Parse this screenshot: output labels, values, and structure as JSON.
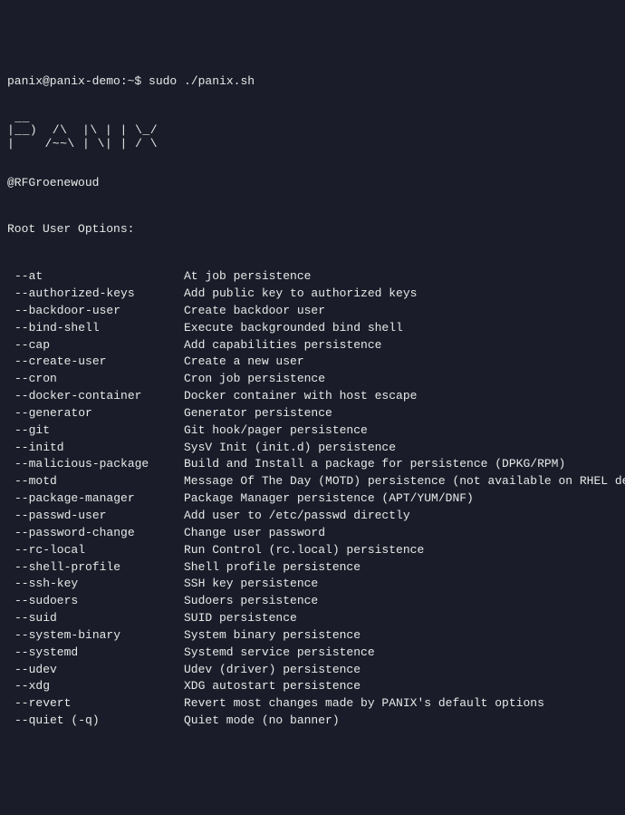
{
  "prompt": "panix@panix-demo:~$ sudo ./panix.sh",
  "ascii_art": " __\n|__)  /\\  |\\ | | \\_/\n|    /~~\\ | \\| | / \\",
  "author": "@RFGroenewoud",
  "section_title": "Root User Options:",
  "options": [
    {
      "flag": "--at",
      "desc": "At job persistence"
    },
    {
      "flag": "--authorized-keys",
      "desc": "Add public key to authorized keys"
    },
    {
      "flag": "--backdoor-user",
      "desc": "Create backdoor user"
    },
    {
      "flag": "--bind-shell",
      "desc": "Execute backgrounded bind shell"
    },
    {
      "flag": "--cap",
      "desc": "Add capabilities persistence"
    },
    {
      "flag": "--create-user",
      "desc": "Create a new user"
    },
    {
      "flag": "--cron",
      "desc": "Cron job persistence"
    },
    {
      "flag": "--docker-container",
      "desc": "Docker container with host escape"
    },
    {
      "flag": "--generator",
      "desc": "Generator persistence"
    },
    {
      "flag": "--git",
      "desc": "Git hook/pager persistence"
    },
    {
      "flag": "--initd",
      "desc": "SysV Init (init.d) persistence"
    },
    {
      "flag": "--malicious-package",
      "desc": "Build and Install a package for persistence (DPKG/RPM)"
    },
    {
      "flag": "--motd",
      "desc": "Message Of The Day (MOTD) persistence (not available on RHEL derivatives"
    },
    {
      "flag": "--package-manager",
      "desc": "Package Manager persistence (APT/YUM/DNF)"
    },
    {
      "flag": "--passwd-user",
      "desc": "Add user to /etc/passwd directly"
    },
    {
      "flag": "--password-change",
      "desc": "Change user password"
    },
    {
      "flag": "--rc-local",
      "desc": "Run Control (rc.local) persistence"
    },
    {
      "flag": "--shell-profile",
      "desc": "Shell profile persistence"
    },
    {
      "flag": "--ssh-key",
      "desc": "SSH key persistence"
    },
    {
      "flag": "--sudoers",
      "desc": "Sudoers persistence"
    },
    {
      "flag": "--suid",
      "desc": "SUID persistence"
    },
    {
      "flag": "--system-binary",
      "desc": "System binary persistence"
    },
    {
      "flag": "--systemd",
      "desc": "Systemd service persistence"
    },
    {
      "flag": "--udev",
      "desc": "Udev (driver) persistence"
    },
    {
      "flag": "--xdg",
      "desc": "XDG autostart persistence"
    },
    {
      "flag": "--revert",
      "desc": "Revert most changes made by PANIX's default options"
    },
    {
      "flag": "--quiet (-q)",
      "desc": "Quiet mode (no banner)"
    }
  ]
}
